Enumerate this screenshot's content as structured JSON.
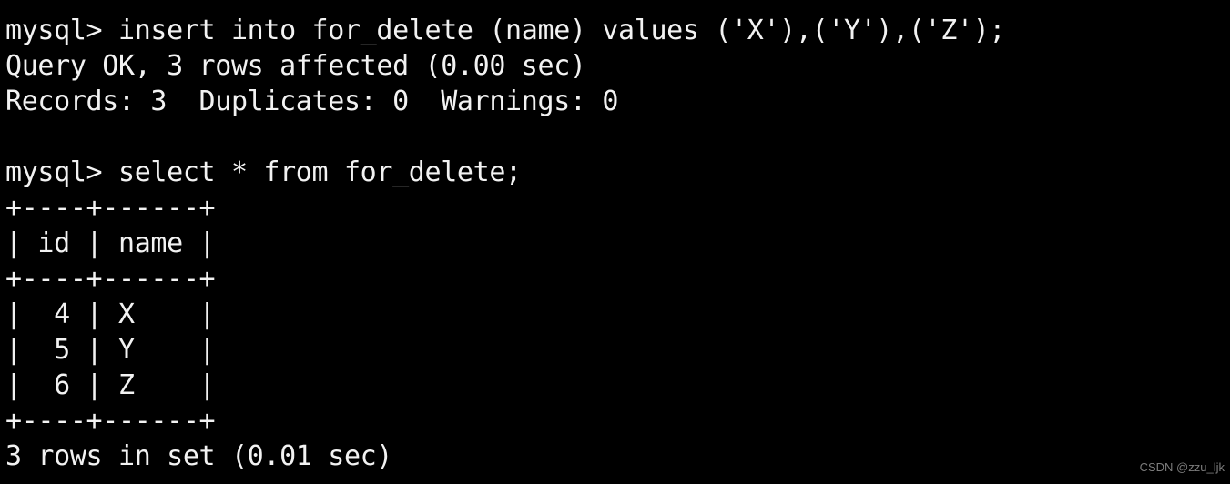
{
  "terminal": {
    "background_color": "#000000",
    "foreground_color": "#f2f2f2",
    "lines": [
      {
        "id": "line-1",
        "text": "mysql> insert into for_delete (name) values ('X'),('Y'),('Z');",
        "kind": "prompt-command"
      },
      {
        "id": "line-2",
        "text": "Query OK, 3 rows affected (0.00 sec)",
        "kind": "status"
      },
      {
        "id": "line-3",
        "text": "Records: 3  Duplicates: 0  Warnings: 0",
        "kind": "status"
      },
      {
        "id": "line-4",
        "text": " ",
        "kind": "blank"
      },
      {
        "id": "line-5",
        "text": "mysql> select * from for_delete;",
        "kind": "prompt-command"
      },
      {
        "id": "line-6",
        "text": "+----+------+",
        "kind": "table-border"
      },
      {
        "id": "line-7",
        "text": "| id | name |",
        "kind": "table-header"
      },
      {
        "id": "line-8",
        "text": "+----+------+",
        "kind": "table-border"
      },
      {
        "id": "line-9",
        "text": "|  4 | X    |",
        "kind": "table-row"
      },
      {
        "id": "line-10",
        "text": "|  5 | Y    |",
        "kind": "table-row"
      },
      {
        "id": "line-11",
        "text": "|  6 | Z    |",
        "kind": "table-row"
      },
      {
        "id": "line-12",
        "text": "+----+------+",
        "kind": "table-border"
      },
      {
        "id": "line-13",
        "text": "3 rows in set (0.01 sec)",
        "kind": "status"
      }
    ],
    "result_table": {
      "columns": [
        "id",
        "name"
      ],
      "rows": [
        [
          "4",
          "X"
        ],
        [
          "5",
          "Y"
        ],
        [
          "6",
          "Z"
        ]
      ],
      "row_count_text": "3 rows in set (0.01 sec)"
    },
    "commands": [
      "insert into for_delete (name) values ('X'),('Y'),('Z');",
      "select * from for_delete;"
    ],
    "prompt": "mysql>"
  },
  "watermark": {
    "text": "CSDN @zzu_ljk",
    "color": "#7d7d7d"
  }
}
